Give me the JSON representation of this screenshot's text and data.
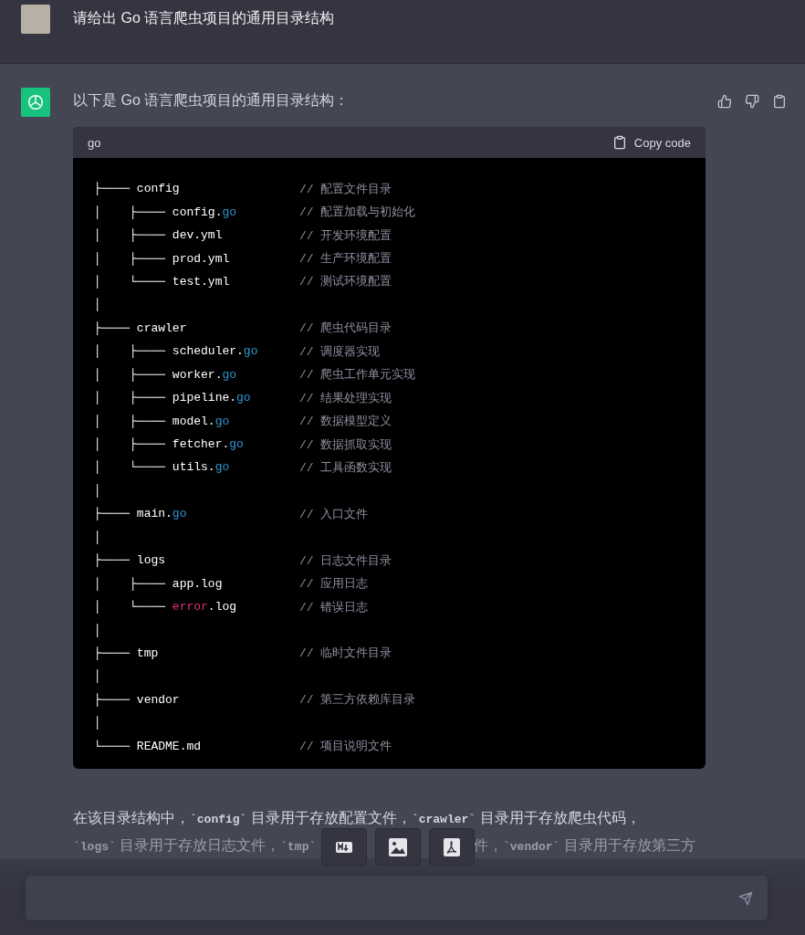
{
  "user_message": {
    "text": "请给出 Go 语言爬虫项目的通用目录结构"
  },
  "assistant_message": {
    "intro": "以下是 Go 语言爬虫项目的通用目录结构：",
    "code_block": {
      "language": "go",
      "copy_label": "Copy code",
      "lines": [
        {
          "prefix": "├────",
          "segments": [
            {
              "text": "config",
              "kind": "plain"
            }
          ],
          "comment": "// 配置文件目录"
        },
        {
          "prefix": "│    ├────",
          "segments": [
            {
              "text": "config.",
              "kind": "plain"
            },
            {
              "text": "go",
              "kind": "keyword"
            }
          ],
          "comment": "// 配置加载与初始化"
        },
        {
          "prefix": "│    ├────",
          "segments": [
            {
              "text": "dev.yml",
              "kind": "plain"
            }
          ],
          "comment": "// 开发环境配置"
        },
        {
          "prefix": "│    ├────",
          "segments": [
            {
              "text": "prod.yml",
              "kind": "plain"
            }
          ],
          "comment": "// 生产环境配置"
        },
        {
          "prefix": "│    └────",
          "segments": [
            {
              "text": "test.yml",
              "kind": "plain"
            }
          ],
          "comment": "// 测试环境配置"
        },
        {
          "prefix": "│"
        },
        {
          "prefix": "├────",
          "segments": [
            {
              "text": "crawler",
              "kind": "plain"
            }
          ],
          "comment": "// 爬虫代码目录"
        },
        {
          "prefix": "│    ├────",
          "segments": [
            {
              "text": "scheduler.",
              "kind": "plain"
            },
            {
              "text": "go",
              "kind": "keyword"
            }
          ],
          "comment": "// 调度器实现"
        },
        {
          "prefix": "│    ├────",
          "segments": [
            {
              "text": "worker.",
              "kind": "plain"
            },
            {
              "text": "go",
              "kind": "keyword"
            }
          ],
          "comment": "// 爬虫工作单元实现"
        },
        {
          "prefix": "│    ├────",
          "segments": [
            {
              "text": "pipeline.",
              "kind": "plain"
            },
            {
              "text": "go",
              "kind": "keyword"
            }
          ],
          "comment": "// 结果处理实现"
        },
        {
          "prefix": "│    ├────",
          "segments": [
            {
              "text": "model.",
              "kind": "plain"
            },
            {
              "text": "go",
              "kind": "keyword"
            }
          ],
          "comment": "// 数据模型定义"
        },
        {
          "prefix": "│    ├────",
          "segments": [
            {
              "text": "fetcher.",
              "kind": "plain"
            },
            {
              "text": "go",
              "kind": "keyword"
            }
          ],
          "comment": "// 数据抓取实现"
        },
        {
          "prefix": "│    └────",
          "segments": [
            {
              "text": "utils.",
              "kind": "plain"
            },
            {
              "text": "go",
              "kind": "keyword"
            }
          ],
          "comment": "// 工具函数实现"
        },
        {
          "prefix": "│"
        },
        {
          "prefix": "├────",
          "segments": [
            {
              "text": "main.",
              "kind": "plain"
            },
            {
              "text": "go",
              "kind": "keyword"
            }
          ],
          "comment": "// 入口文件"
        },
        {
          "prefix": "│"
        },
        {
          "prefix": "├────",
          "segments": [
            {
              "text": "logs",
              "kind": "plain"
            }
          ],
          "comment": "// 日志文件目录"
        },
        {
          "prefix": "│    ├────",
          "segments": [
            {
              "text": "app.log",
              "kind": "plain"
            }
          ],
          "comment": "// 应用日志"
        },
        {
          "prefix": "│    └────",
          "segments": [
            {
              "text": "error",
              "kind": "builtin"
            },
            {
              "text": ".log",
              "kind": "plain"
            }
          ],
          "comment": "// 错误日志"
        },
        {
          "prefix": "│"
        },
        {
          "prefix": "├────",
          "segments": [
            {
              "text": "tmp",
              "kind": "plain"
            }
          ],
          "comment": "// 临时文件目录"
        },
        {
          "prefix": "│"
        },
        {
          "prefix": "├────",
          "segments": [
            {
              "text": "vendor",
              "kind": "plain"
            }
          ],
          "comment": "// 第三方依赖库目录"
        },
        {
          "prefix": "│"
        },
        {
          "prefix": "└────",
          "segments": [
            {
              "text": "README.md",
              "kind": "plain"
            }
          ],
          "comment": "// 项目说明文件"
        }
      ]
    },
    "summary_lines": [
      {
        "parts": [
          "在该目录结构中，**`config`** 目录用于存放配置文件，**`crawler`** 目录用于存放爬虫代码，"
        ]
      },
      {
        "parts": [
          "**`logs`** 目录用于存放日志文件，**`tmp`**",
          "件，**`vendor`** 目录用于存放第三方"
        ]
      }
    ]
  },
  "export_buttons": [
    {
      "kind": "markdown"
    },
    {
      "kind": "image"
    },
    {
      "kind": "pdf"
    }
  ]
}
